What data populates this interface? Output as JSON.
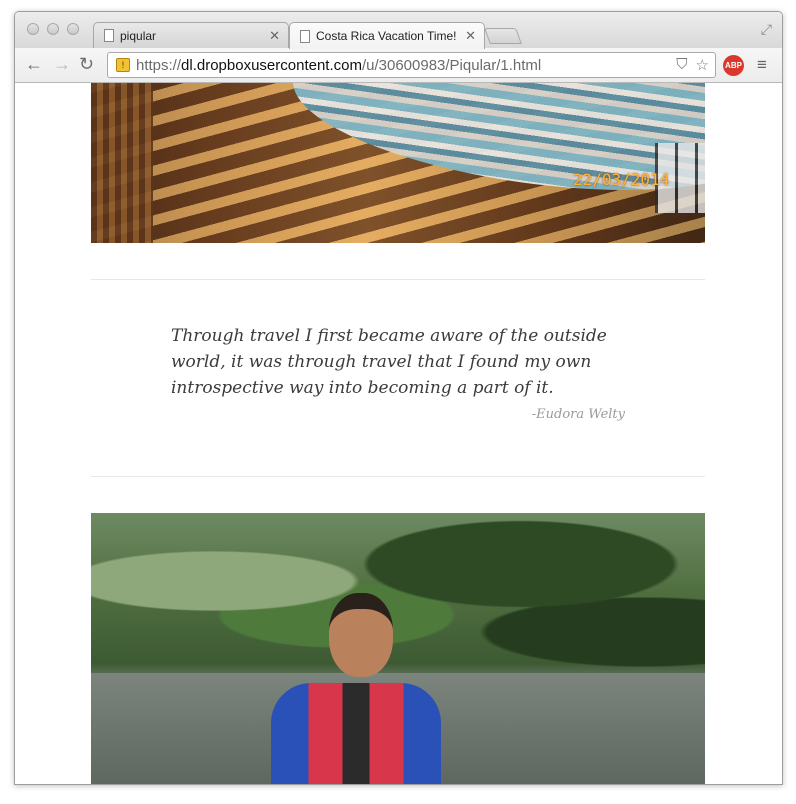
{
  "browser": {
    "tabs": [
      {
        "label": "piqular",
        "active": false
      },
      {
        "label": "Costa Rica Vacation Time!",
        "active": true
      }
    ],
    "url": {
      "scheme": "https://",
      "host": "dl.dropboxusercontent.com",
      "path": "/u/30600983/Piqular/1.html"
    },
    "extension_badge": "ABP"
  },
  "page": {
    "photo_top": {
      "date_stamp": "22/03/2014"
    },
    "quote": {
      "text": "Through travel I first became aware of the outside world, it was through travel that I found my own introspective way into becoming a part of it.",
      "author": "-Eudora Welty"
    }
  },
  "colors": {
    "abp_badge": "#d9382c",
    "date_stamp": "#ffb23a",
    "quote_text": "#3b3b3b",
    "quote_author": "#9a9a9a"
  }
}
